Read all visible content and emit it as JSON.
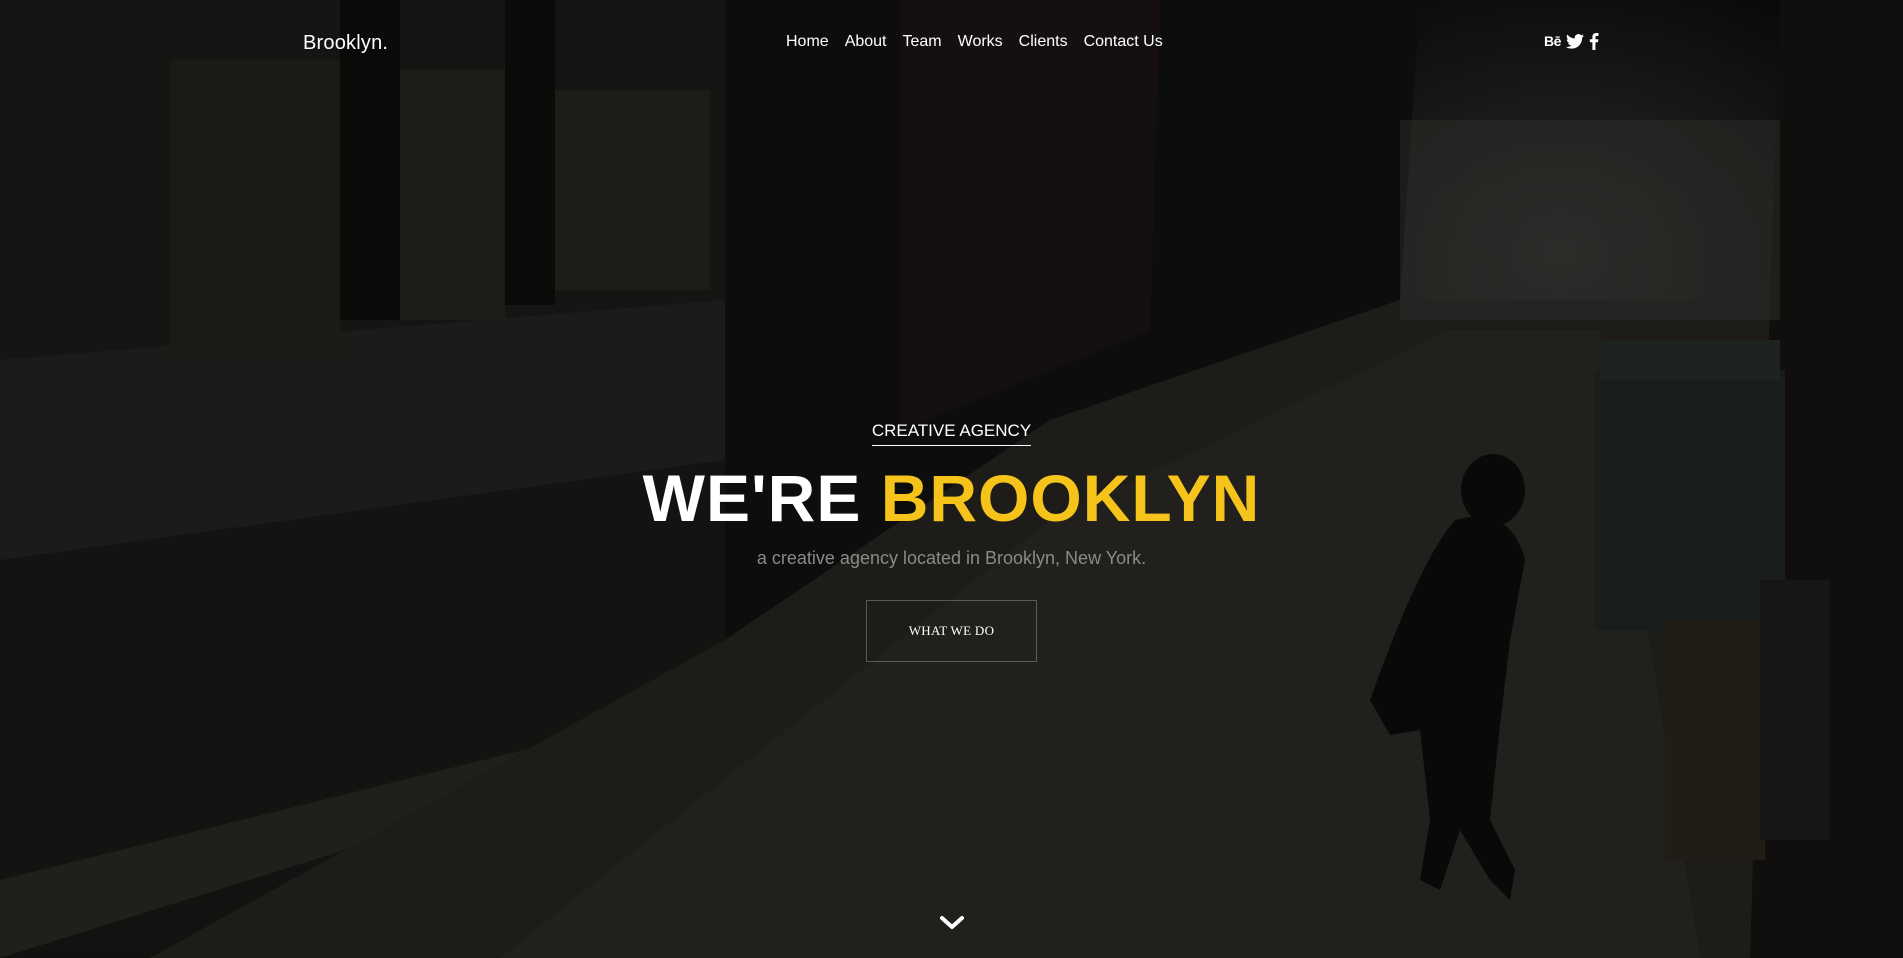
{
  "header": {
    "brand": "Brooklyn.",
    "nav": [
      "Home",
      "About",
      "Team",
      "Works",
      "Clients",
      "Contact Us"
    ],
    "social": [
      {
        "icon": "behance-icon",
        "glyph": "Bē"
      },
      {
        "icon": "twitter-icon"
      },
      {
        "icon": "facebook-icon"
      }
    ]
  },
  "hero": {
    "kicker": "CREATIVE AGENCY",
    "headline_white": "WE'RE ",
    "headline_accent": "BROOKLYN",
    "subtitle": "a creative agency located in Brooklyn, New York.",
    "cta": "WHAT WE DO",
    "scroll_icon": "chevron-down-icon"
  },
  "colors": {
    "accent": "#f6c31b",
    "text": "#ffffff",
    "subtitle": "#8a8a86"
  }
}
